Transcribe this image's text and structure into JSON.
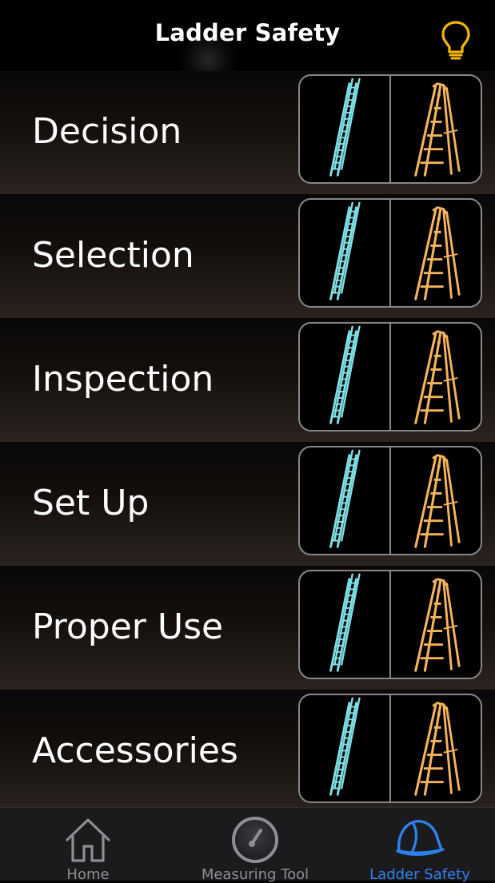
{
  "header": {
    "title": "Ladder Safety",
    "bulb_icon": "lightbulb-icon",
    "bulb_color": "#f5b800"
  },
  "rows": [
    {
      "label": "Decision"
    },
    {
      "label": "Selection"
    },
    {
      "label": "Inspection"
    },
    {
      "label": "Set Up"
    },
    {
      "label": "Proper Use"
    },
    {
      "label": "Accessories"
    }
  ],
  "ladder_icons": {
    "extension": {
      "icon": "extension-ladder-icon",
      "color": "#7ee0e6"
    },
    "step": {
      "icon": "step-ladder-icon",
      "color": "#f5b35a"
    }
  },
  "tabbar": {
    "tabs": [
      {
        "label": "Home",
        "icon": "house-icon",
        "active": false
      },
      {
        "label": "Measuring Tool",
        "icon": "gauge-icon",
        "active": false
      },
      {
        "label": "Ladder Safety",
        "icon": "hard-hat-icon",
        "active": true
      }
    ],
    "active_color": "#2f80ef",
    "inactive_color": "#8e8e93"
  }
}
